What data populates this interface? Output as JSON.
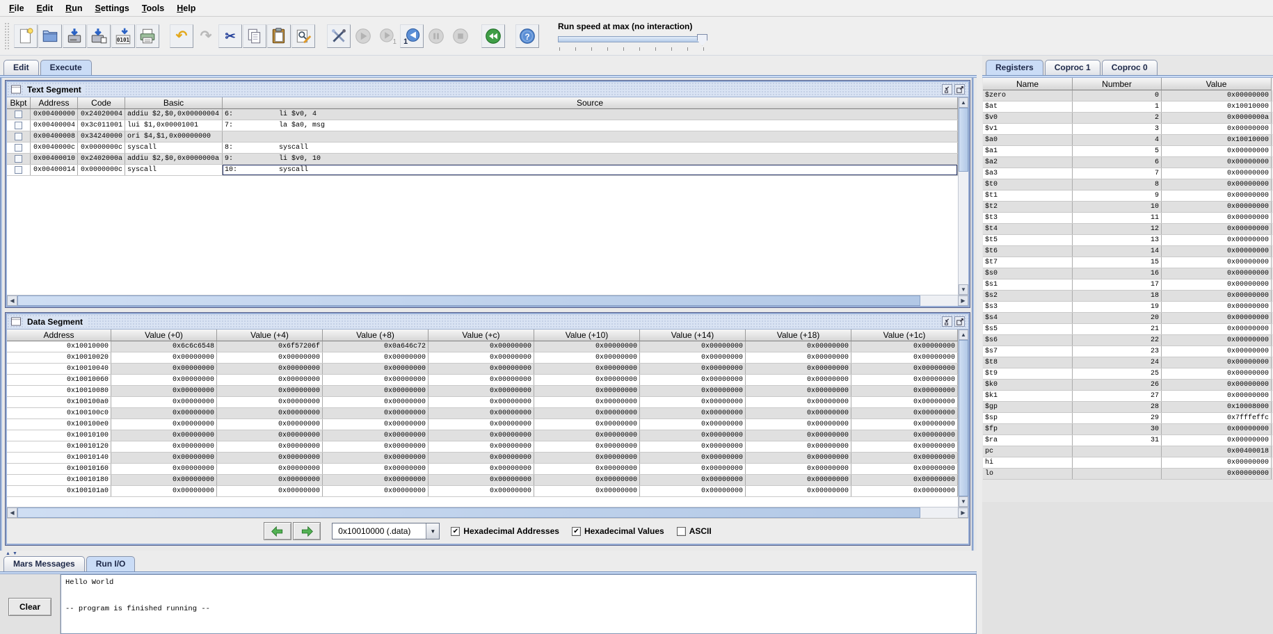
{
  "menu": {
    "items": [
      "File",
      "Edit",
      "Run",
      "Settings",
      "Tools",
      "Help"
    ]
  },
  "toolbar": {
    "run_speed_label": "Run speed at max (no interaction)",
    "run_speed_ticks": 10,
    "buttons": [
      {
        "name": "new-file",
        "enabled": true
      },
      {
        "name": "open-file",
        "enabled": true
      },
      {
        "name": "save-file",
        "enabled": true
      },
      {
        "name": "save-as",
        "enabled": true
      },
      {
        "name": "dump-memory",
        "enabled": true
      },
      {
        "name": "print",
        "enabled": true
      },
      {
        "name": "undo",
        "enabled": true
      },
      {
        "name": "redo",
        "enabled": false
      },
      {
        "name": "cut",
        "enabled": true
      },
      {
        "name": "copy",
        "enabled": true
      },
      {
        "name": "paste",
        "enabled": true
      },
      {
        "name": "find-replace",
        "enabled": true
      },
      {
        "name": "assemble",
        "enabled": true
      },
      {
        "name": "run",
        "enabled": false
      },
      {
        "name": "step",
        "enabled": false
      },
      {
        "name": "backstep",
        "enabled": true
      },
      {
        "name": "pause",
        "enabled": false
      },
      {
        "name": "stop",
        "enabled": false
      },
      {
        "name": "reset",
        "enabled": true
      },
      {
        "name": "help",
        "enabled": true
      }
    ]
  },
  "main_tabs": [
    {
      "label": "Edit",
      "selected": false
    },
    {
      "label": "Execute",
      "selected": true
    }
  ],
  "text_segment": {
    "title": "Text Segment",
    "columns": [
      "Bkpt",
      "Address",
      "Code",
      "Basic",
      "Source"
    ],
    "rows": [
      {
        "bkpt": false,
        "address": "0x00400000",
        "code": "0x24020004",
        "basic": "addiu $2,$0,0x00000004",
        "line": "6:",
        "source": "li $v0, 4",
        "selected": false
      },
      {
        "bkpt": false,
        "address": "0x00400004",
        "code": "0x3c011001",
        "basic": "lui $1,0x00001001",
        "line": "7:",
        "source": "la $a0, msg",
        "selected": false
      },
      {
        "bkpt": false,
        "address": "0x00400008",
        "code": "0x34240000",
        "basic": "ori $4,$1,0x00000000",
        "line": "",
        "source": "",
        "selected": false
      },
      {
        "bkpt": false,
        "address": "0x0040000c",
        "code": "0x0000000c",
        "basic": "syscall",
        "line": "8:",
        "source": "syscall",
        "selected": false
      },
      {
        "bkpt": false,
        "address": "0x00400010",
        "code": "0x2402000a",
        "basic": "addiu $2,$0,0x0000000a",
        "line": "9:",
        "source": "li $v0, 10",
        "selected": false
      },
      {
        "bkpt": false,
        "address": "0x00400014",
        "code": "0x0000000c",
        "basic": "syscall",
        "line": "10:",
        "source": "syscall",
        "selected": true
      }
    ]
  },
  "data_segment": {
    "title": "Data Segment",
    "columns": [
      "Address",
      "Value (+0)",
      "Value (+4)",
      "Value (+8)",
      "Value (+c)",
      "Value (+10)",
      "Value (+14)",
      "Value (+18)",
      "Value (+1c)"
    ],
    "rows": [
      {
        "address": "0x10010000",
        "values": [
          "0x6c6c6548",
          "0x6f57206f",
          "0x0a646c72",
          "0x00000000",
          "0x00000000",
          "0x00000000",
          "0x00000000",
          "0x00000000"
        ]
      },
      {
        "address": "0x10010020",
        "values": [
          "0x00000000",
          "0x00000000",
          "0x00000000",
          "0x00000000",
          "0x00000000",
          "0x00000000",
          "0x00000000",
          "0x00000000"
        ]
      },
      {
        "address": "0x10010040",
        "values": [
          "0x00000000",
          "0x00000000",
          "0x00000000",
          "0x00000000",
          "0x00000000",
          "0x00000000",
          "0x00000000",
          "0x00000000"
        ]
      },
      {
        "address": "0x10010060",
        "values": [
          "0x00000000",
          "0x00000000",
          "0x00000000",
          "0x00000000",
          "0x00000000",
          "0x00000000",
          "0x00000000",
          "0x00000000"
        ]
      },
      {
        "address": "0x10010080",
        "values": [
          "0x00000000",
          "0x00000000",
          "0x00000000",
          "0x00000000",
          "0x00000000",
          "0x00000000",
          "0x00000000",
          "0x00000000"
        ]
      },
      {
        "address": "0x100100a0",
        "values": [
          "0x00000000",
          "0x00000000",
          "0x00000000",
          "0x00000000",
          "0x00000000",
          "0x00000000",
          "0x00000000",
          "0x00000000"
        ]
      },
      {
        "address": "0x100100c0",
        "values": [
          "0x00000000",
          "0x00000000",
          "0x00000000",
          "0x00000000",
          "0x00000000",
          "0x00000000",
          "0x00000000",
          "0x00000000"
        ]
      },
      {
        "address": "0x100100e0",
        "values": [
          "0x00000000",
          "0x00000000",
          "0x00000000",
          "0x00000000",
          "0x00000000",
          "0x00000000",
          "0x00000000",
          "0x00000000"
        ]
      },
      {
        "address": "0x10010100",
        "values": [
          "0x00000000",
          "0x00000000",
          "0x00000000",
          "0x00000000",
          "0x00000000",
          "0x00000000",
          "0x00000000",
          "0x00000000"
        ]
      },
      {
        "address": "0x10010120",
        "values": [
          "0x00000000",
          "0x00000000",
          "0x00000000",
          "0x00000000",
          "0x00000000",
          "0x00000000",
          "0x00000000",
          "0x00000000"
        ]
      },
      {
        "address": "0x10010140",
        "values": [
          "0x00000000",
          "0x00000000",
          "0x00000000",
          "0x00000000",
          "0x00000000",
          "0x00000000",
          "0x00000000",
          "0x00000000"
        ]
      },
      {
        "address": "0x10010160",
        "values": [
          "0x00000000",
          "0x00000000",
          "0x00000000",
          "0x00000000",
          "0x00000000",
          "0x00000000",
          "0x00000000",
          "0x00000000"
        ]
      },
      {
        "address": "0x10010180",
        "values": [
          "0x00000000",
          "0x00000000",
          "0x00000000",
          "0x00000000",
          "0x00000000",
          "0x00000000",
          "0x00000000",
          "0x00000000"
        ]
      },
      {
        "address": "0x100101a0",
        "values": [
          "0x00000000",
          "0x00000000",
          "0x00000000",
          "0x00000000",
          "0x00000000",
          "0x00000000",
          "0x00000000",
          "0x00000000"
        ]
      }
    ],
    "controls": {
      "prev_icon": "green-left-arrow-icon",
      "next_icon": "green-right-arrow-icon",
      "combo_value": "0x10010000 (.data)",
      "combo_arrow_icon": "chevron-down-icon",
      "checkboxes": [
        {
          "label": "Hexadecimal Addresses",
          "checked": true
        },
        {
          "label": "Hexadecimal Values",
          "checked": true
        },
        {
          "label": "ASCII",
          "checked": false
        }
      ]
    }
  },
  "messages": {
    "tabs": [
      {
        "label": "Mars Messages",
        "selected": false
      },
      {
        "label": "Run I/O",
        "selected": true
      }
    ],
    "clear_label": "Clear",
    "output_lines": [
      "Hello World",
      "",
      "-- program is finished running --"
    ]
  },
  "registers": {
    "tabs": [
      {
        "label": "Registers",
        "selected": true
      },
      {
        "label": "Coproc 1",
        "selected": false
      },
      {
        "label": "Coproc 0",
        "selected": false
      }
    ],
    "columns": [
      "Name",
      "Number",
      "Value"
    ],
    "rows": [
      {
        "name": "$zero",
        "number": "0",
        "value": "0x00000000"
      },
      {
        "name": "$at",
        "number": "1",
        "value": "0x10010000"
      },
      {
        "name": "$v0",
        "number": "2",
        "value": "0x0000000a"
      },
      {
        "name": "$v1",
        "number": "3",
        "value": "0x00000000"
      },
      {
        "name": "$a0",
        "number": "4",
        "value": "0x10010000"
      },
      {
        "name": "$a1",
        "number": "5",
        "value": "0x00000000"
      },
      {
        "name": "$a2",
        "number": "6",
        "value": "0x00000000"
      },
      {
        "name": "$a3",
        "number": "7",
        "value": "0x00000000"
      },
      {
        "name": "$t0",
        "number": "8",
        "value": "0x00000000"
      },
      {
        "name": "$t1",
        "number": "9",
        "value": "0x00000000"
      },
      {
        "name": "$t2",
        "number": "10",
        "value": "0x00000000"
      },
      {
        "name": "$t3",
        "number": "11",
        "value": "0x00000000"
      },
      {
        "name": "$t4",
        "number": "12",
        "value": "0x00000000"
      },
      {
        "name": "$t5",
        "number": "13",
        "value": "0x00000000"
      },
      {
        "name": "$t6",
        "number": "14",
        "value": "0x00000000"
      },
      {
        "name": "$t7",
        "number": "15",
        "value": "0x00000000"
      },
      {
        "name": "$s0",
        "number": "16",
        "value": "0x00000000"
      },
      {
        "name": "$s1",
        "number": "17",
        "value": "0x00000000"
      },
      {
        "name": "$s2",
        "number": "18",
        "value": "0x00000000"
      },
      {
        "name": "$s3",
        "number": "19",
        "value": "0x00000000"
      },
      {
        "name": "$s4",
        "number": "20",
        "value": "0x00000000"
      },
      {
        "name": "$s5",
        "number": "21",
        "value": "0x00000000"
      },
      {
        "name": "$s6",
        "number": "22",
        "value": "0x00000000"
      },
      {
        "name": "$s7",
        "number": "23",
        "value": "0x00000000"
      },
      {
        "name": "$t8",
        "number": "24",
        "value": "0x00000000"
      },
      {
        "name": "$t9",
        "number": "25",
        "value": "0x00000000"
      },
      {
        "name": "$k0",
        "number": "26",
        "value": "0x00000000"
      },
      {
        "name": "$k1",
        "number": "27",
        "value": "0x00000000"
      },
      {
        "name": "$gp",
        "number": "28",
        "value": "0x10008000"
      },
      {
        "name": "$sp",
        "number": "29",
        "value": "0x7fffeffc"
      },
      {
        "name": "$fp",
        "number": "30",
        "value": "0x00000000"
      },
      {
        "name": "$ra",
        "number": "31",
        "value": "0x00000000"
      },
      {
        "name": "pc",
        "number": "",
        "value": "0x00400018"
      },
      {
        "name": "hi",
        "number": "",
        "value": "0x00000000"
      },
      {
        "name": "lo",
        "number": "",
        "value": "0x00000000"
      }
    ]
  }
}
